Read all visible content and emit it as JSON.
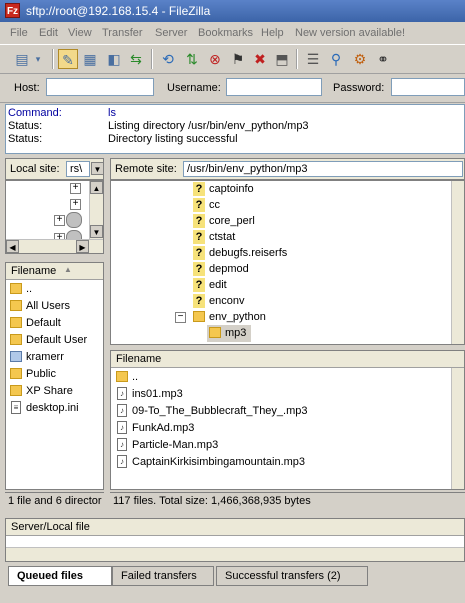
{
  "window": {
    "title": "sftp://root@192.168.15.4 - FileZilla"
  },
  "menu": [
    "File",
    "Edit",
    "View",
    "Transfer",
    "Server",
    "Bookmarks",
    "Help",
    "New version available!"
  ],
  "quickconnect": {
    "host_label": "Host:",
    "username_label": "Username:",
    "password_label": "Password:",
    "host_value": "",
    "username_value": "",
    "password_value": ""
  },
  "log": [
    {
      "type": "Command:",
      "text": "ls"
    },
    {
      "type": "Status:",
      "text": "Listing directory /usr/bin/env_python/mp3"
    },
    {
      "type": "Status:",
      "text": "Directory listing successful"
    }
  ],
  "local": {
    "site_label": "Local site:",
    "site_value": "rs\\",
    "filename_header": "Filename",
    "files": [
      {
        "name": "..",
        "icon": "folder-up-icon"
      },
      {
        "name": "All Users",
        "icon": "folder-icon"
      },
      {
        "name": "Default",
        "icon": "folder-icon"
      },
      {
        "name": "Default User",
        "icon": "folder-icon"
      },
      {
        "name": "kramerr",
        "icon": "user-folder-icon"
      },
      {
        "name": "Public",
        "icon": "folder-icon"
      },
      {
        "name": "XP Share",
        "icon": "folder-icon"
      },
      {
        "name": "desktop.ini",
        "icon": "ini-file-icon"
      }
    ],
    "status": "1 file and 6 director"
  },
  "remote": {
    "site_label": "Remote site:",
    "site_value": "/usr/bin/env_python/mp3",
    "tree": [
      {
        "name": "captoinfo",
        "icon": "unknown-icon"
      },
      {
        "name": "cc",
        "icon": "unknown-icon"
      },
      {
        "name": "core_perl",
        "icon": "unknown-icon"
      },
      {
        "name": "ctstat",
        "icon": "unknown-icon"
      },
      {
        "name": "debugfs.reiserfs",
        "icon": "unknown-icon"
      },
      {
        "name": "depmod",
        "icon": "unknown-icon"
      },
      {
        "name": "edit",
        "icon": "unknown-icon"
      },
      {
        "name": "enconv",
        "icon": "unknown-icon"
      },
      {
        "name": "env_python",
        "icon": "folder-open-icon"
      },
      {
        "name": "mp3",
        "icon": "folder-icon"
      }
    ],
    "filename_header": "Filename",
    "files": [
      {
        "name": "..",
        "icon": "folder-up-icon"
      },
      {
        "name": "ins01.mp3",
        "icon": "audio-file-icon"
      },
      {
        "name": "09-To_The_Bubblecraft_They_.mp3",
        "icon": "audio-file-icon"
      },
      {
        "name": "FunkAd.mp3",
        "icon": "audio-file-icon"
      },
      {
        "name": "Particle-Man.mp3",
        "icon": "audio-file-icon"
      },
      {
        "name": "CaptainKirkisimbingamountain.mp3",
        "icon": "audio-file-icon"
      }
    ],
    "status": "117 files. Total size: 1,466,368,935 bytes"
  },
  "queue": {
    "header": "Server/Local file"
  },
  "tabs": [
    {
      "label": "Queued files",
      "active": true
    },
    {
      "label": "Failed transfers",
      "active": false
    },
    {
      "label": "Successful transfers (2)",
      "active": false
    }
  ],
  "colors": {
    "title_bar": "#3c64a8",
    "selection": "#d4d0c8",
    "folder": "#f4c74f"
  }
}
